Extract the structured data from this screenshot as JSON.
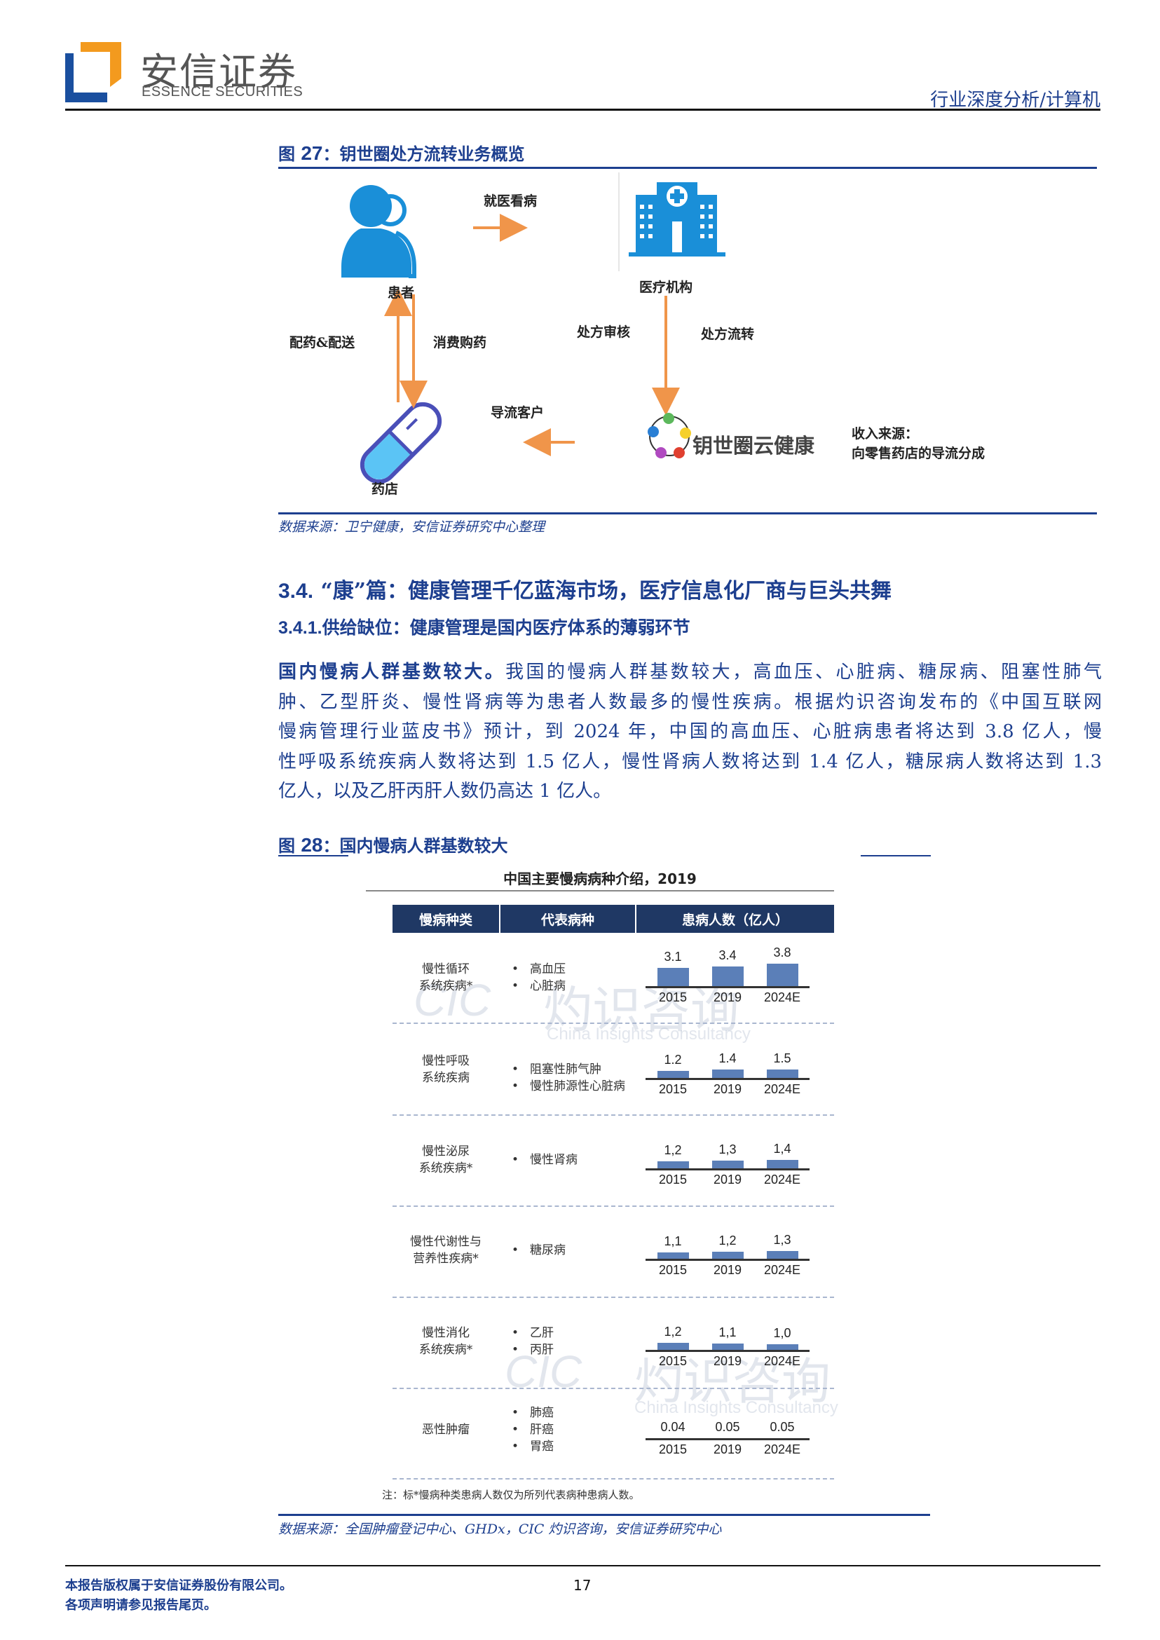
{
  "header": {
    "brand_cn": "安信证券",
    "brand_en": "ESSENCE SECURITIES",
    "section": "行业深度分析/计算机",
    "logo_colors": {
      "orange": "#f39a1e",
      "blue": "#1a4f9f"
    }
  },
  "fig27": {
    "label": "图",
    "number": "27",
    "title": "：钥世圈处方流转业务概览",
    "nodes": {
      "patient": "患者",
      "hospital": "医疗机构",
      "pharmacy": "药店",
      "platform": "钥世圈云健康"
    },
    "edges": {
      "visit": "就医看病",
      "dispense": "配药&配送",
      "purchase": "消费购药",
      "review": "处方审核",
      "transfer": "处方流转",
      "divert": "导流客户"
    },
    "revenue_title": "收入来源：",
    "revenue_text": "向零售药店的导流分成",
    "source": "数据来源：卫宁健康，安信证券研究中心整理",
    "arrow_color": "#f0954a",
    "icon_color": "#1a8fd8"
  },
  "section": {
    "h2_num": "3.4.",
    "h2_text": "“康”篇：健康管理千亿蓝海市场，医疗信息化厂商与巨头共舞",
    "h3_num": "3.4.1.",
    "h3_text": "供给缺位：健康管理是国内医疗体系的薄弱环节",
    "lead": "国内慢病人群基数较大。",
    "lines": [
      "我国的慢病人群基数较大，高血压、心脏病、糖尿病、阻塞性肺气",
      "肿、乙型肝炎、慢性肾病等为患者人数最多的慢性疾病。根据灼识咨询发布的《中国互联网",
      "慢病管理行业蓝皮书》预计，到 2024 年，中国的高血压、心脏病患者将达到 3.8 亿人，慢",
      "性呼吸系统疾病人数将达到 1.5 亿人，慢性肾病人数将达到 1.4 亿人，糖尿病人数将达到 1.3",
      "亿人，以及乙肝丙肝人数仍高达 1 亿人。"
    ]
  },
  "fig28": {
    "label": "图",
    "number": "28",
    "title": "：国内慢病人群基数较大",
    "source": "数据来源：全国肿瘤登记中心、GHDx，CIC 灼识咨询，安信证券研究中心",
    "watermark_cn": "灼识咨询",
    "watermark_logo": "CIC",
    "watermark_en": "China Insights Consultancy"
  },
  "chart_data": {
    "type": "table",
    "title": "中国主要慢病病种介绍，2019",
    "columns": [
      "慢病种类",
      "代表病种",
      "患病人数（亿人）"
    ],
    "years": [
      "2015",
      "2019",
      "2024E"
    ],
    "bar_color": "#5b7fb8",
    "header_color": "#1f3864",
    "rows": [
      {
        "category": [
          "慢性循环",
          "系统疾病*"
        ],
        "diseases": [
          "高血压",
          "心脏病"
        ],
        "values": [
          3.1,
          3.4,
          3.8
        ],
        "labels": [
          "3.1",
          "3.4",
          "3.8"
        ]
      },
      {
        "category": [
          "慢性呼吸",
          "系统疾病"
        ],
        "diseases": [
          "阻塞性肺气肿",
          "慢性肺源性心脏病"
        ],
        "values": [
          1.2,
          1.4,
          1.5
        ],
        "labels": [
          "1.2",
          "1.4",
          "1.5"
        ]
      },
      {
        "category": [
          "慢性泌尿",
          "系统疾病*"
        ],
        "diseases": [
          "慢性肾病"
        ],
        "values": [
          1.2,
          1.3,
          1.4
        ],
        "labels": [
          "1,2",
          "1,3",
          "1,4"
        ]
      },
      {
        "category": [
          "慢性代谢性与",
          "营养性疾病*"
        ],
        "diseases": [
          "糖尿病"
        ],
        "values": [
          1.1,
          1.2,
          1.3
        ],
        "labels": [
          "1,1",
          "1,2",
          "1,3"
        ]
      },
      {
        "category": [
          "慢性消化",
          "系统疾病*"
        ],
        "diseases": [
          "乙肝",
          "丙肝"
        ],
        "values": [
          1.2,
          1.1,
          1.0
        ],
        "labels": [
          "1,2",
          "1,1",
          "1,0"
        ]
      },
      {
        "category": [
          "恶性肿瘤"
        ],
        "diseases": [
          "肺癌",
          "肝癌",
          "胃癌"
        ],
        "values": [
          0.04,
          0.05,
          0.05
        ],
        "labels": [
          "0.04",
          "0.05",
          "0.05"
        ]
      }
    ],
    "note": "注：标*慢病种类患病人数仅为所列代表病种患病人数。"
  },
  "footer": {
    "line1": "本报告版权属于安信证券股份有限公司。",
    "line2": "各项声明请参见报告尾页。",
    "page": "17"
  }
}
